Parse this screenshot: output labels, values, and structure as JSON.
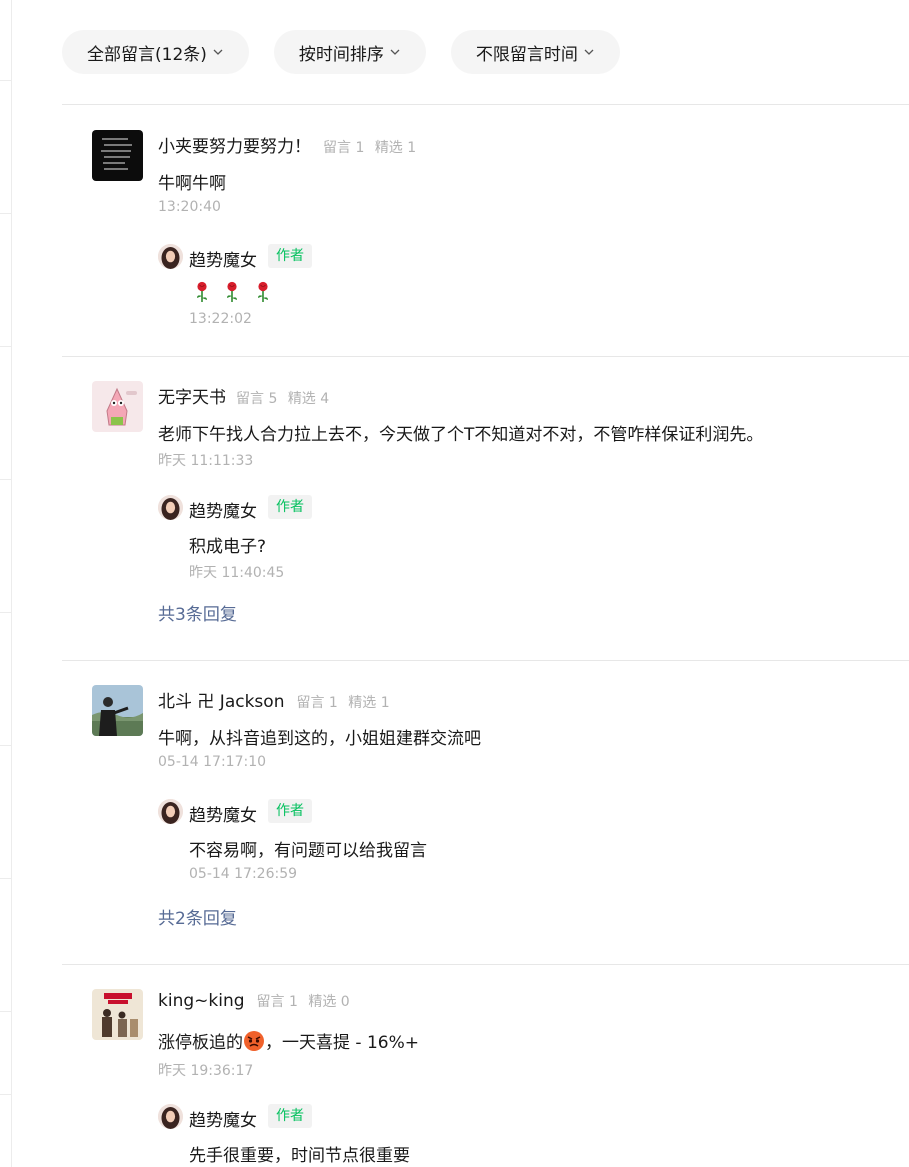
{
  "filters": {
    "all_comments": "全部留言(12条)",
    "sort_by_time": "按时间排序",
    "time_range": "不限留言时间"
  },
  "author": {
    "name": "趋势魔女",
    "badge": "作者"
  },
  "comments": [
    {
      "nick": "小夹要努力要努力！",
      "stat_comments": "留言 1",
      "stat_selected": "精选 1",
      "content": "牛啊牛啊",
      "time": "13:20:40",
      "reply": {
        "content_icons": [
          "rose-emoji",
          "rose-emoji",
          "rose-emoji"
        ],
        "time": "13:22:02"
      }
    },
    {
      "nick": "无字天书",
      "stat_comments": "留言 5",
      "stat_selected": "精选 4",
      "content": "老师下午找人合力拉上去不，今天做了个T不知道对不对，不管咋样保证利润先。",
      "time": "昨天 11:11:33",
      "reply": {
        "content": "积成电子?",
        "time": "昨天 11:40:45"
      },
      "more": "共3条回复"
    },
    {
      "nick": "北斗 卍 Jackson",
      "stat_comments": "留言 1",
      "stat_selected": "精选 1",
      "content": "牛啊，从抖音追到这的，小姐姐建群交流吧",
      "time": "05-14 17:17:10",
      "reply": {
        "content": "不容易啊，有问题可以给我留言",
        "time": "05-14 17:26:59"
      },
      "more": "共2条回复"
    },
    {
      "nick": "king~king",
      "stat_comments": "留言 1",
      "stat_selected": "精选 0",
      "content_before": "涨停板追的",
      "content_emoji": "angry-face-emoji",
      "content_after": "，一天喜提 - 16%+",
      "time": "昨天 19:36:17",
      "reply": {
        "content": "先手很重要，时间节点很重要"
      }
    }
  ]
}
